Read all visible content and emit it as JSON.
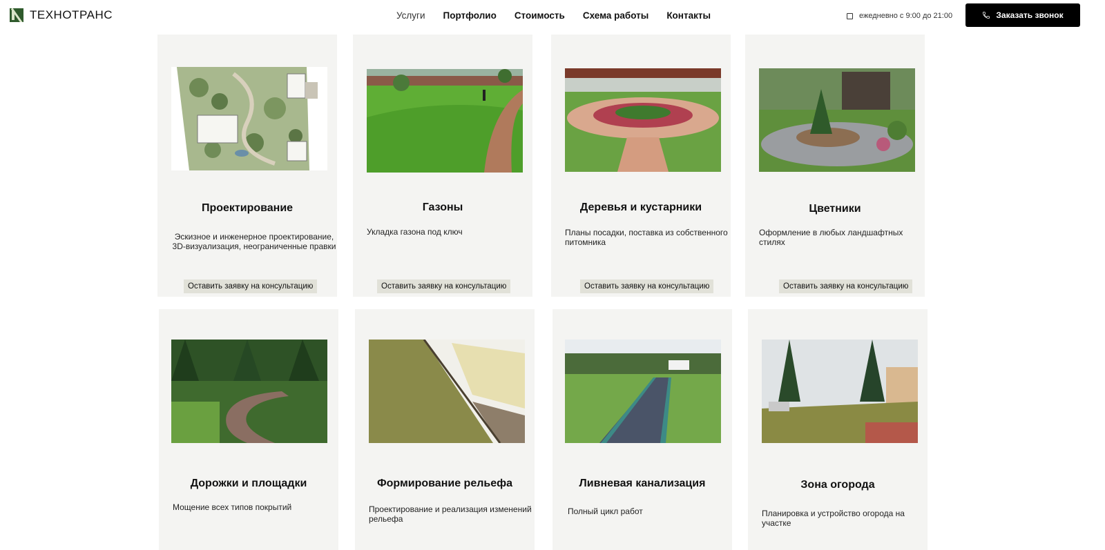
{
  "header": {
    "logo_text": "ТЕХНОТРАНС",
    "nav": [
      "Услуги",
      "Портфолио",
      "Стоимость",
      "Схема работы",
      "Контакты"
    ],
    "hours": "ежедневно с 9:00 до 21:00",
    "call_button": "Заказать звонок"
  },
  "services": [
    {
      "title": "Проектирование",
      "description": "Эскизное и инженерное проектирование, 3D-визуализация, неограниченные правки",
      "cta": "Оставить заявку на консультацию"
    },
    {
      "title": "Газоны",
      "description": "Укладка газона под ключ",
      "cta": "Оставить заявку на консультацию"
    },
    {
      "title": "Деревья и кустарники",
      "description": "Планы посадки, поставка из собственного питомника",
      "cta": "Оставить заявку на консультацию"
    },
    {
      "title": "Цветники",
      "description": "Оформление в любых ландшафтных стилях",
      "cta": "Оставить заявку на консультацию"
    },
    {
      "title": "Дорожки и площадки",
      "description": "Мощение всех типов покрытий"
    },
    {
      "title": "Формирование рельефа",
      "description": "Проектирование и реализация изменений рельефа"
    },
    {
      "title": "Ливневая канализация",
      "description": "Полный цикл работ"
    },
    {
      "title": "Зона огорода",
      "description": "Планировка и устройство огорода на участке"
    }
  ]
}
